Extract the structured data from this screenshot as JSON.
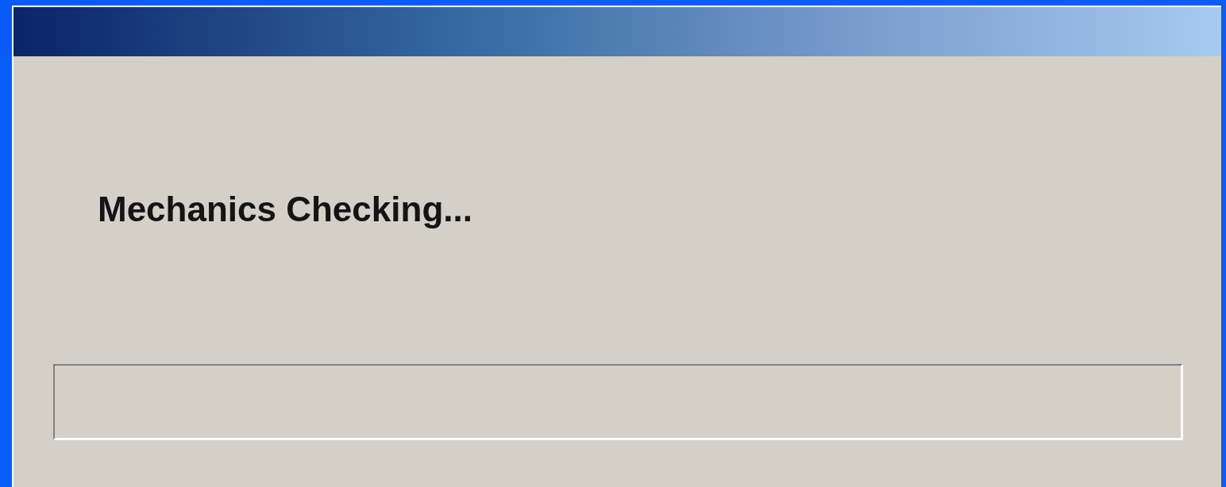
{
  "window": {
    "title_bar": {
      "kind": "gradient"
    }
  },
  "message": "Mechanics Checking...",
  "progress": {
    "level": 0
  }
}
